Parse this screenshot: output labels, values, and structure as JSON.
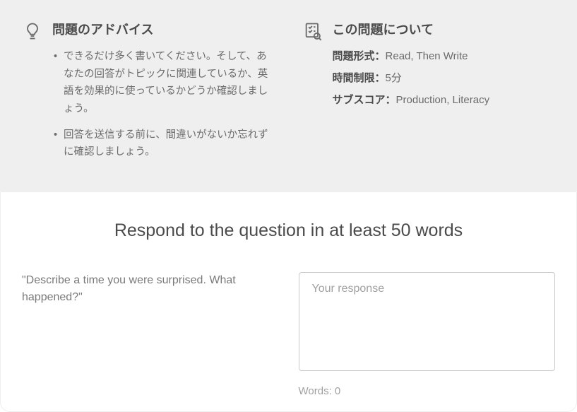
{
  "advice": {
    "title": "問題のアドバイス",
    "tips": [
      "できるだけ多く書いてください。そして、あなたの回答がトピックに関連しているか、英語を効果的に使っているかどうか確認しましょう。",
      "回答を送信する前に、間違いがないか忘れずに確認しましょう。"
    ]
  },
  "about": {
    "title": "この問題について",
    "format_label": "問題形式：",
    "format_value": "Read, Then Write",
    "time_label": "時間制限：",
    "time_value": "5分",
    "subscore_label": "サブスコア：",
    "subscore_value": "Production, Literacy"
  },
  "question": {
    "instruction": "Respond to the question in at least 50 words",
    "prompt": "\"Describe a time you were surprised. What happened?\"",
    "placeholder": "Your response",
    "word_count_label": "Words: ",
    "word_count_value": "0"
  }
}
